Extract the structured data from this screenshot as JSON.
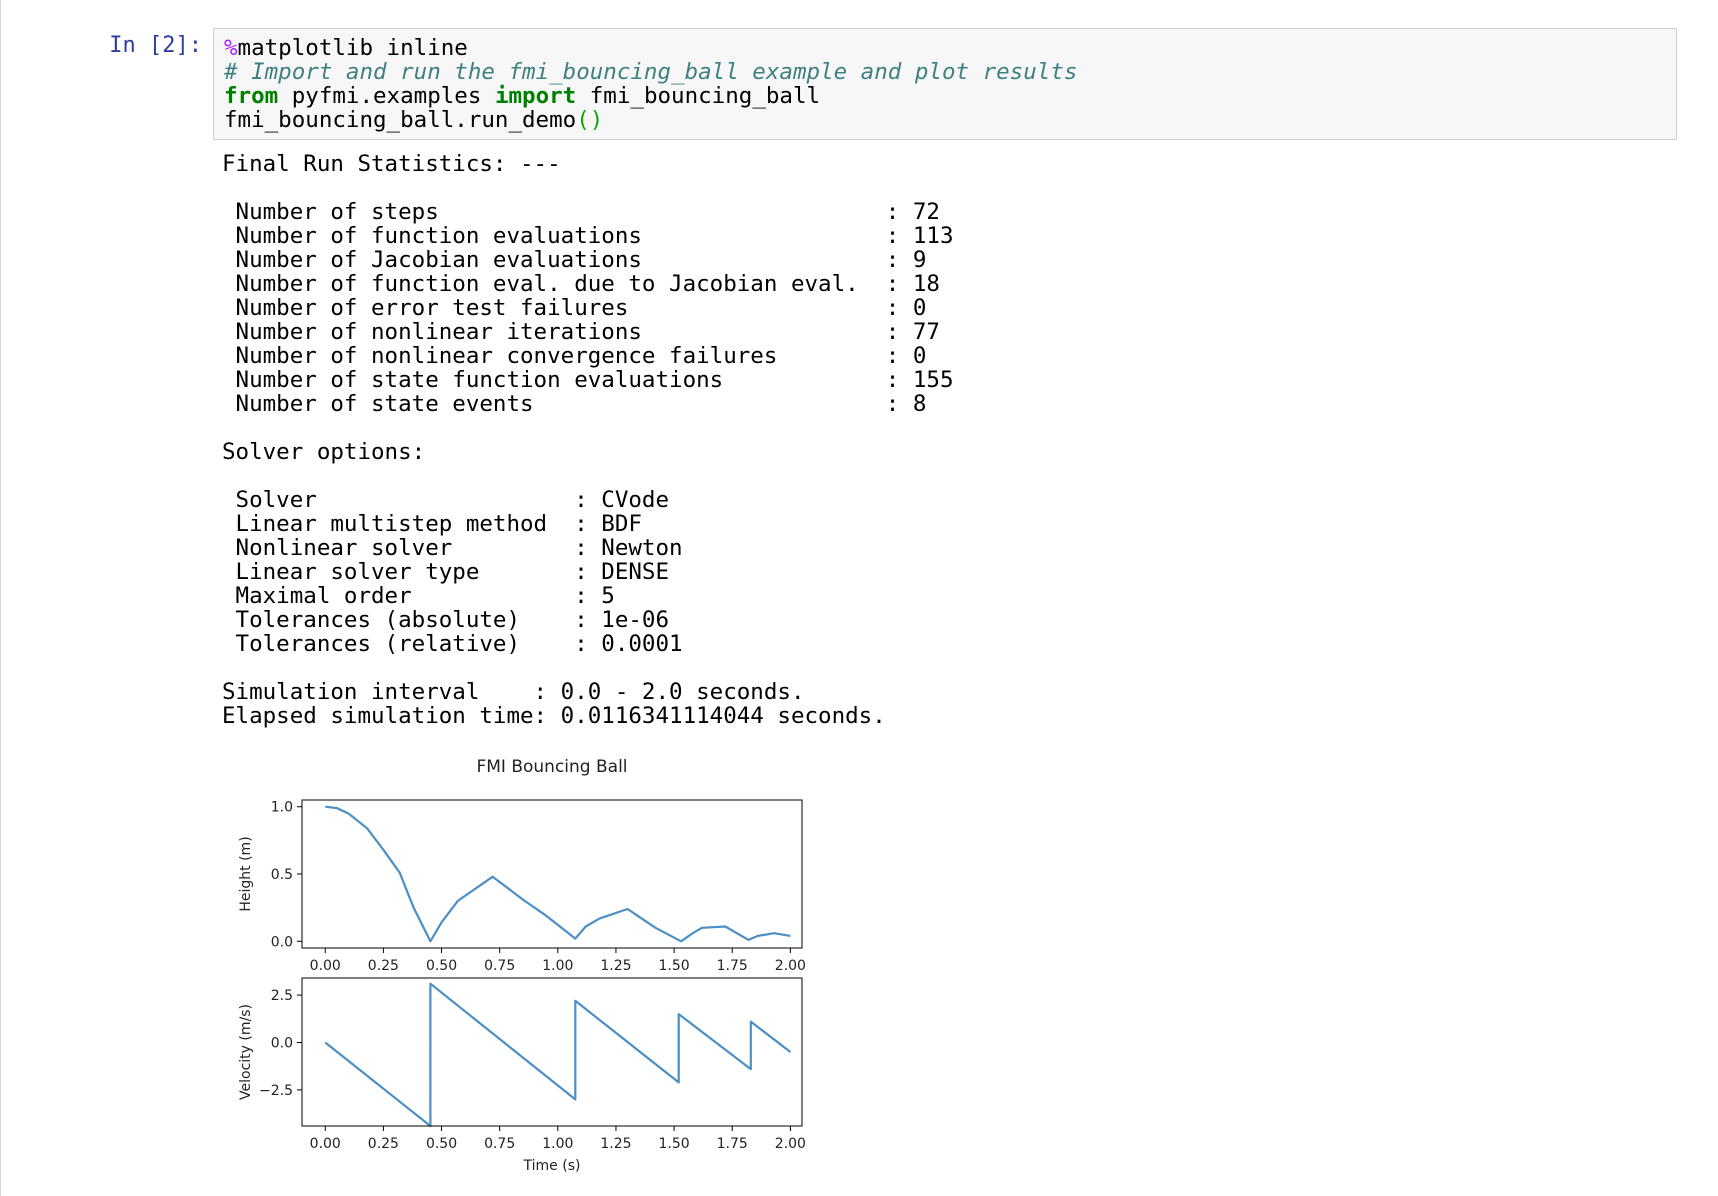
{
  "cell": {
    "prompt": "In [2]:",
    "code": {
      "line1_magic": "%",
      "line1_rest": "matplotlib inline",
      "line2_comment": "# Import and run the fmi_bouncing_ball example and plot results",
      "line3_from": "from",
      "line3_mid": " pyfmi.examples ",
      "line3_import": "import",
      "line3_end": " fmi_bouncing_ball",
      "line4_call": "fmi_bouncing_ball.run_demo",
      "line4_parens": "()"
    }
  },
  "output": {
    "lines": [
      "Final Run Statistics: ---",
      "",
      " Number of steps                                 : 72",
      " Number of function evaluations                  : 113",
      " Number of Jacobian evaluations                  : 9",
      " Number of function eval. due to Jacobian eval.  : 18",
      " Number of error test failures                   : 0",
      " Number of nonlinear iterations                  : 77",
      " Number of nonlinear convergence failures        : 0",
      " Number of state function evaluations            : 155",
      " Number of state events                          : 8",
      "",
      "Solver options:",
      "",
      " Solver                   : CVode",
      " Linear multistep method  : BDF",
      " Nonlinear solver         : Newton",
      " Linear solver type       : DENSE",
      " Maximal order            : 5",
      " Tolerances (absolute)    : 1e-06",
      " Tolerances (relative)    : 0.0001",
      "",
      "Simulation interval    : 0.0 - 2.0 seconds.",
      "Elapsed simulation time: 0.0116341114044 seconds."
    ]
  },
  "chart_data": [
    {
      "type": "line",
      "title": "FMI Bouncing Ball",
      "xlabel": "",
      "ylabel": "Height (m)",
      "xlim": [
        -0.1,
        2.05
      ],
      "ylim": [
        -0.05,
        1.05
      ],
      "xticks": [
        "0.00",
        "0.25",
        "0.50",
        "0.75",
        "1.00",
        "1.25",
        "1.50",
        "1.75",
        "2.00"
      ],
      "yticks": [
        "0.0",
        "0.5",
        "1.0"
      ],
      "line_color": "#4c8fc4",
      "series": [
        {
          "x": [
            0.0,
            0.05,
            0.1,
            0.18,
            0.25,
            0.32,
            0.38,
            0.452,
            0.5,
            0.57,
            0.72,
            0.85,
            0.95,
            1.075,
            1.12,
            1.18,
            1.3,
            1.42,
            1.53,
            1.58,
            1.62,
            1.72,
            1.82,
            1.86,
            1.93,
            2.0
          ],
          "y": [
            1.0,
            0.99,
            0.95,
            0.84,
            0.68,
            0.51,
            0.25,
            0.0,
            0.14,
            0.3,
            0.48,
            0.31,
            0.19,
            0.02,
            0.11,
            0.17,
            0.24,
            0.1,
            0.0,
            0.06,
            0.1,
            0.11,
            0.01,
            0.04,
            0.06,
            0.04
          ]
        }
      ]
    },
    {
      "type": "line",
      "title": "",
      "xlabel": "Time (s)",
      "ylabel": "Velocity (m/s)",
      "xlim": [
        -0.1,
        2.05
      ],
      "ylim": [
        -4.4,
        3.4
      ],
      "xticks": [
        "0.00",
        "0.25",
        "0.50",
        "0.75",
        "1.00",
        "1.25",
        "1.50",
        "1.75",
        "2.00"
      ],
      "yticks": [
        "−2.5",
        "0.0",
        "2.5"
      ],
      "line_color": "#4c8fc4",
      "series": [
        {
          "x": [
            0.0,
            0.452,
            0.452,
            1.075,
            1.075,
            1.52,
            1.52,
            1.83,
            1.83,
            2.0
          ],
          "y": [
            0.0,
            -4.4,
            3.1,
            -3.0,
            2.2,
            -2.1,
            1.5,
            -1.4,
            1.1,
            -0.5
          ]
        }
      ]
    }
  ]
}
